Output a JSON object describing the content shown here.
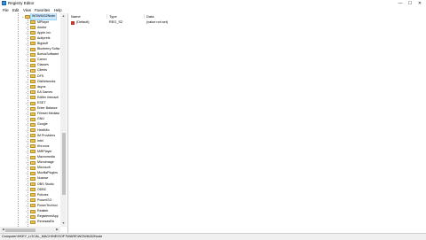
{
  "window": {
    "title": "Registry Editor",
    "minimize_glyph": "—",
    "maximize_glyph": "☐",
    "close_glyph": "✕"
  },
  "menu": [
    "File",
    "Edit",
    "View",
    "Favorites",
    "Help"
  ],
  "tree": {
    "selected": "WOW6432Node",
    "items": [
      "MPlayer",
      "Adobe",
      "Apple Inc.",
      "AutIprefs",
      "Bigstuff",
      "Blueberry Softw",
      "BonusSoftware",
      "Canon",
      "Classes",
      "Clients",
      "DFS",
      "DtsNetworks",
      "dsyns",
      "EA Games",
      "Edifier Interacti",
      "ESET",
      "Enter Balance",
      "Filmset Mediasi",
      "GNU",
      "Google",
      "HeidiMix",
      "IM Providers",
      "Intel",
      "Khronos",
      "MiRPlayer",
      "Macromedia",
      "Microimage",
      "Microsoft",
      "MozillaPlugins",
      "Nuance",
      "OBS Studio",
      "ODBC",
      "Policies",
      "PowerISO",
      "PowerTechnol",
      "Realtek",
      "RegisteredApp",
      "RenesasElc"
    ]
  },
  "list": {
    "columns": [
      "Name",
      "Type",
      "Data"
    ],
    "rows": [
      {
        "name": "(Default)",
        "type": "REG_SZ",
        "data": "(value not set)"
      }
    ]
  },
  "status": {
    "path": "Computer\\HKEY_LOCAL_MACHINE\\SOFTWARE\\WOW6432Node"
  }
}
